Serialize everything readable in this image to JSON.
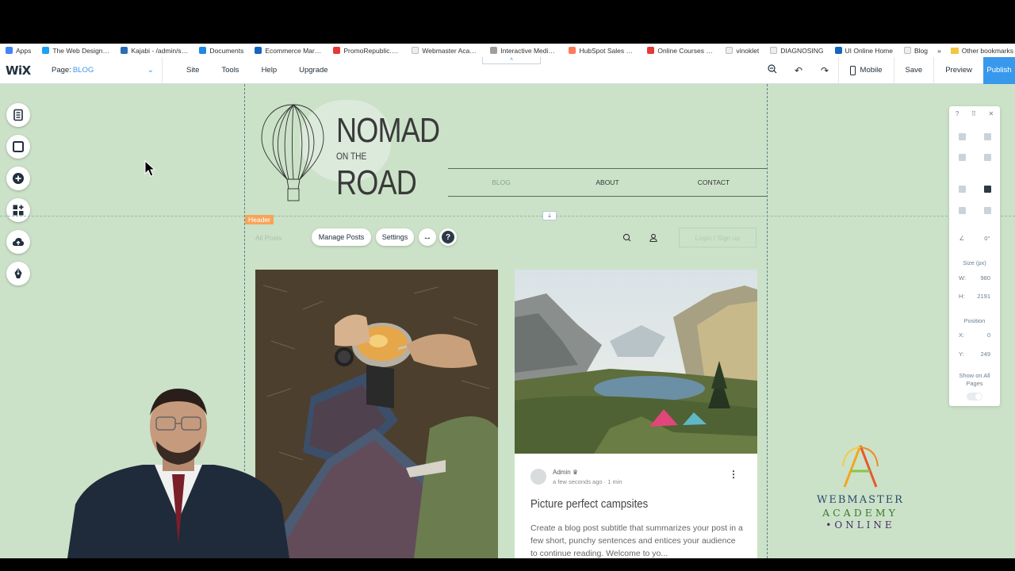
{
  "bookmarks": {
    "items": [
      {
        "label": "Apps",
        "color": "#4285f4"
      },
      {
        "label": "The Web Design Tre",
        "color": "#1da1f2"
      },
      {
        "label": "Kajabi - /admin/sites",
        "color": "#2a6db6"
      },
      {
        "label": "Documents",
        "color": "#1e88e5"
      },
      {
        "label": "Ecommerce Marketi",
        "color": "#1565c0"
      },
      {
        "label": "PromoRepublic.com",
        "color": "#e53935"
      },
      {
        "label": "Webmaster Academ",
        "color": "#f5f5f5"
      },
      {
        "label": "Interactive Media fo",
        "color": "#9e9e9e"
      },
      {
        "label": "HubSpot Sales Pricir",
        "color": "#ff7a59"
      },
      {
        "label": "Online Courses - Any",
        "color": "#e53935"
      },
      {
        "label": "vinoklet",
        "color": "#9e9e9e"
      },
      {
        "label": "DIAGNOSING",
        "color": "#9e9e9e"
      },
      {
        "label": "UI Online Home",
        "color": "#1565c0"
      },
      {
        "label": "Blog",
        "color": "#9e9e9e"
      }
    ],
    "more": "»",
    "other": "Other bookmarks"
  },
  "wixbar": {
    "logo": "WiX",
    "page_label": "Page:",
    "page_value": "BLOG",
    "menu": [
      "Site",
      "Tools",
      "Help",
      "Upgrade"
    ],
    "mobile": "Mobile",
    "save": "Save",
    "preview": "Preview",
    "publish": "Publish",
    "accent": "#3899ec"
  },
  "site": {
    "title_top": "NOMAD",
    "title_mid": "ON THE",
    "title_bottom": "ROAD",
    "nav": [
      "BLOG",
      "ABOUT",
      "CONTACT"
    ],
    "header_tag": "Header"
  },
  "blog": {
    "all_posts": "All Posts",
    "manage_posts": "Manage Posts",
    "settings": "Settings",
    "help": "?",
    "login": "Login / Sign up",
    "post": {
      "author": "Admin",
      "time": "a few seconds ago",
      "read": "1 min",
      "title": "Picture perfect campsites",
      "subtitle": "Create a blog post subtitle that summarizes your post in a few short, punchy sentences and entices your audience to continue reading. Welcome to yo..."
    }
  },
  "panel": {
    "help": "?",
    "angle": "0°",
    "size_label": "Size (px)",
    "w_label": "W:",
    "w_value": "980",
    "h_label": "H:",
    "h_value": "2191",
    "position_label": "Position",
    "x_label": "X:",
    "x_value": "0",
    "y_label": "Y:",
    "y_value": "249",
    "show_all": "Show on All Pages"
  },
  "watermark": {
    "line1": "WEBMASTER",
    "line2": "ACADEMY",
    "line3": "•ONLINE"
  }
}
